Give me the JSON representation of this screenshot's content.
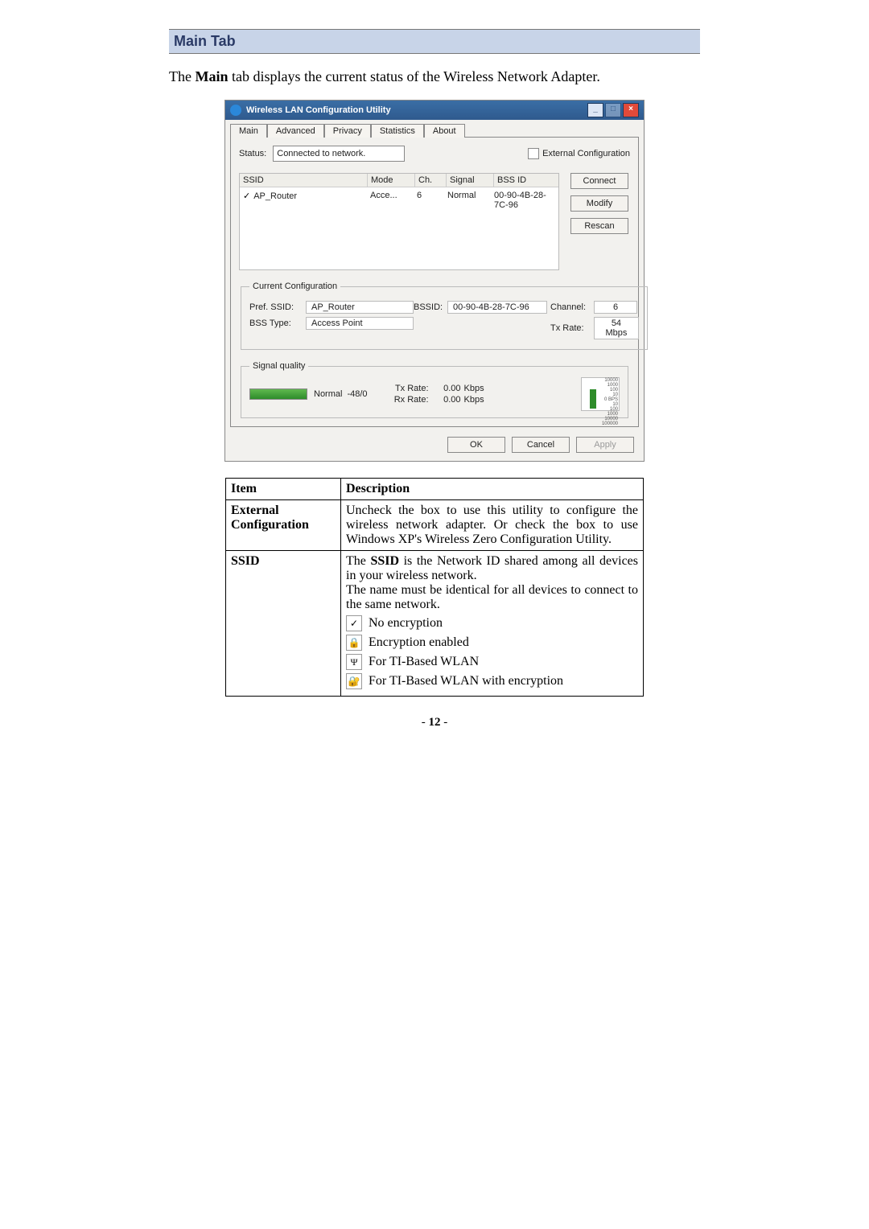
{
  "header": {
    "title": "Main Tab"
  },
  "intro_prefix": "The ",
  "intro_bold": "Main",
  "intro_suffix": " tab displays the current status of the Wireless Network Adapter.",
  "window": {
    "title": "Wireless LAN Configuration Utility",
    "tabs": [
      "Main",
      "Advanced",
      "Privacy",
      "Statistics",
      "About"
    ],
    "status_label": "Status:",
    "status_value": "Connected to network.",
    "ext_cfg_label": "External Configuration",
    "list_headers": {
      "ssid": "SSID",
      "mode": "Mode",
      "ch": "Ch.",
      "signal": "Signal",
      "bssid": "BSS ID"
    },
    "list_row": {
      "ssid": "AP_Router",
      "mode": "Acce...",
      "ch": "6",
      "signal": "Normal",
      "bssid": "00-90-4B-28-7C-96"
    },
    "buttons": {
      "connect": "Connect",
      "modify": "Modify",
      "rescan": "Rescan"
    },
    "cc": {
      "legend": "Current Configuration",
      "pref_ssid_label": "Pref. SSID:",
      "pref_ssid": "AP_Router",
      "bss_type_label": "BSS Type:",
      "bss_type": "Access Point",
      "bssid_label": "BSSID:",
      "bssid": "00-90-4B-28-7C-96",
      "channel_label": "Channel:",
      "channel": "6",
      "txrate_label": "Tx Rate:",
      "txrate": "54 Mbps"
    },
    "sig": {
      "legend": "Signal quality",
      "quality": "Normal",
      "value": "-48/0",
      "tx_label": "Tx Rate:",
      "tx_val": "0.00",
      "rx_label": "Rx Rate:",
      "rx_val": "0.00",
      "unit": "Kbps",
      "meter_ticks": [
        "10000",
        "1000",
        "100",
        "10",
        "0 BPS",
        "10",
        "100",
        "1000",
        "10000",
        "100000"
      ]
    },
    "dlg": {
      "ok": "OK",
      "cancel": "Cancel",
      "apply": "Apply"
    }
  },
  "table": {
    "head_item": "Item",
    "head_desc": "Description",
    "r1_item1": "External",
    "r1_item2": "Configuration",
    "r1_desc": "Uncheck the box to use this utility to configure the wireless network adapter. Or check the box to use Windows XP's Wireless Zero Configuration Utility.",
    "r2_item": "SSID",
    "r2_prefix": "The ",
    "r2_bold": "SSID",
    "r2_rest": " is the Network ID shared among all devices in your wireless network.",
    "r2_line2": "The name must be identical for all devices to connect to the same network.",
    "r2_icons": {
      "a": "No encryption",
      "b": "Encryption enabled",
      "c": "For TI-Based WLAN",
      "d": "For TI-Based WLAN with encryption"
    }
  },
  "page_prefix": "- ",
  "page_num": "12",
  "page_suffix": " -"
}
